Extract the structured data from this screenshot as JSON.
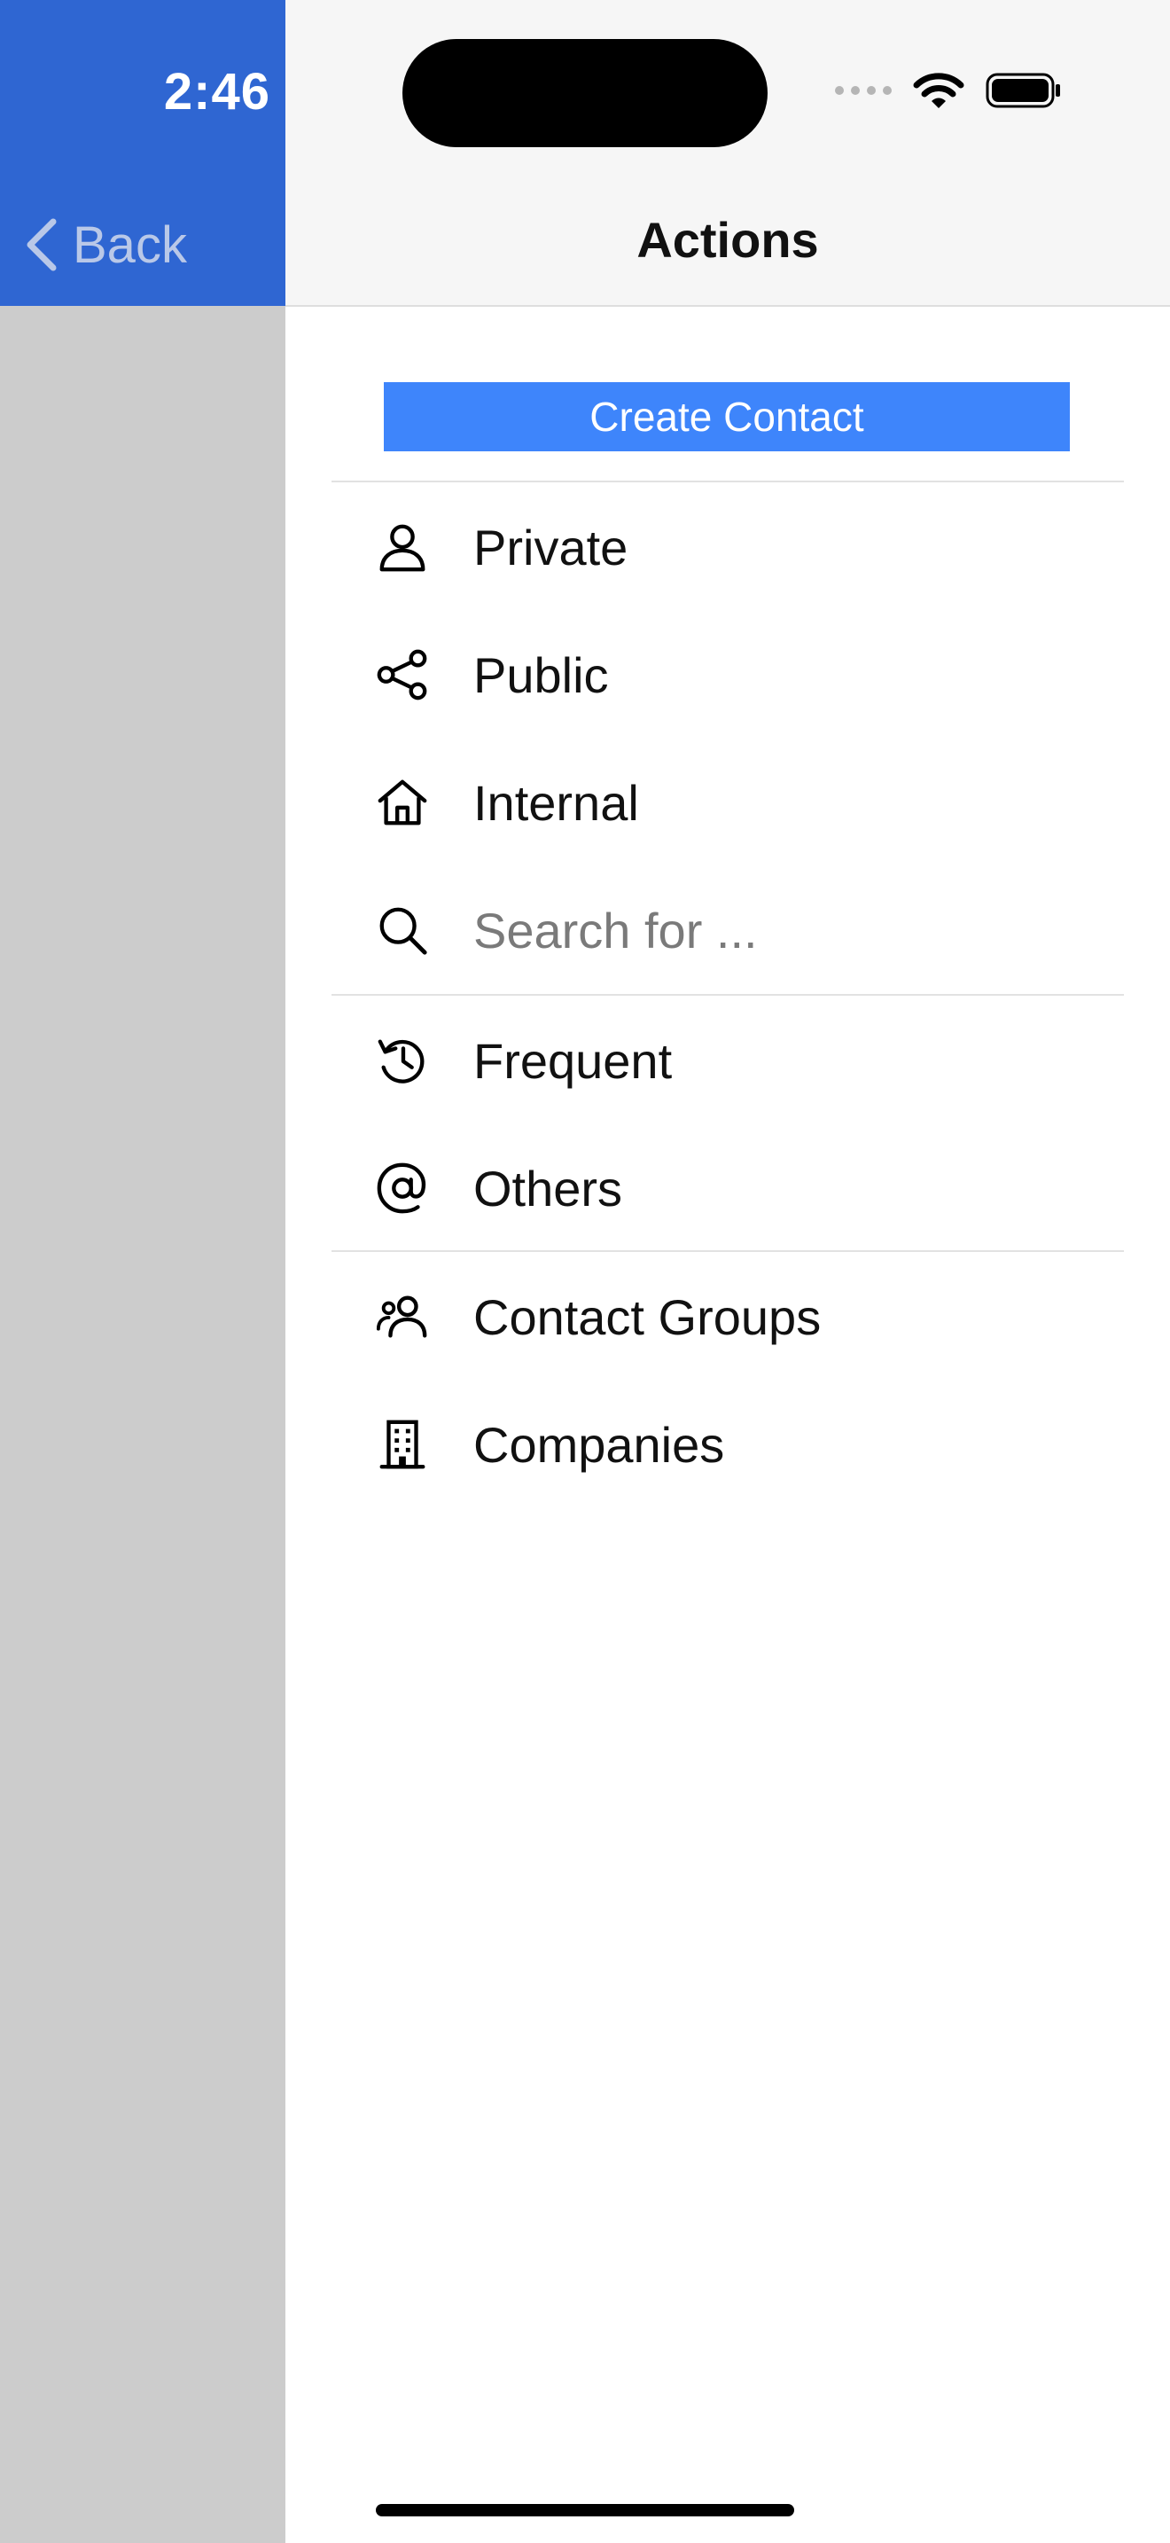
{
  "status_bar": {
    "time": "2:46"
  },
  "back_app": {
    "back_label": "Back"
  },
  "nav": {
    "title": "Actions"
  },
  "create_button": {
    "label": "Create Contact"
  },
  "menu": [
    {
      "label": "Private",
      "icon": "person-icon"
    },
    {
      "label": "Public",
      "icon": "share-icon"
    },
    {
      "label": "Internal",
      "icon": "home-icon"
    },
    {
      "label": "Frequent",
      "icon": "history-icon"
    },
    {
      "label": "Others",
      "icon": "at-sign-icon"
    },
    {
      "label": "Contact Groups",
      "icon": "group-icon"
    },
    {
      "label": "Companies",
      "icon": "building-icon"
    }
  ],
  "search": {
    "placeholder": "Search for ..."
  },
  "colors": {
    "back_app_blue": "#2f66d2",
    "back_app_gray": "#cccccc",
    "accent_button": "#3e85fb",
    "header_bg": "#f6f6f6"
  }
}
